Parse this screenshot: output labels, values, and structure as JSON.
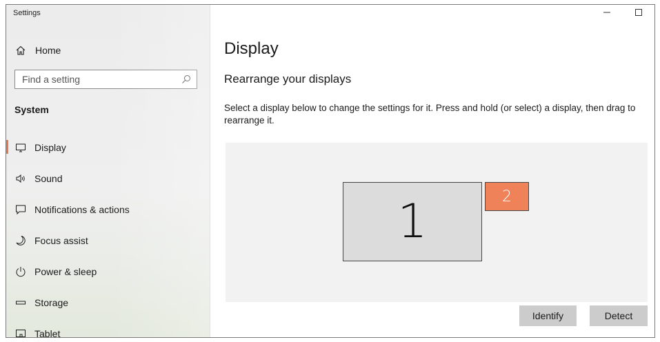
{
  "window": {
    "title": "Settings"
  },
  "sidebar": {
    "home_label": "Home",
    "search_placeholder": "Find a setting",
    "section_label": "System",
    "items": [
      {
        "label": "Display",
        "icon": "monitor-icon",
        "active": true
      },
      {
        "label": "Sound",
        "icon": "speaker-icon"
      },
      {
        "label": "Notifications & actions",
        "icon": "notification-icon"
      },
      {
        "label": "Focus assist",
        "icon": "moon-icon"
      },
      {
        "label": "Power & sleep",
        "icon": "power-icon"
      },
      {
        "label": "Storage",
        "icon": "storage-icon"
      },
      {
        "label": "Tablet",
        "icon": "tablet-icon"
      }
    ]
  },
  "main": {
    "title": "Display",
    "subheading": "Rearrange your displays",
    "description": "Select a display below to change the settings for it. Press and hold (or select) a display, then drag to rearrange it.",
    "displays": [
      {
        "label": "1",
        "selected": false
      },
      {
        "label": "2",
        "selected": true
      }
    ],
    "identify_label": "Identify",
    "detect_label": "Detect"
  },
  "colors": {
    "accent": "#f0825a",
    "active_indicator": "#e07a55",
    "button_bg": "#cccccc",
    "arrange_bg": "#f2f2f2"
  }
}
